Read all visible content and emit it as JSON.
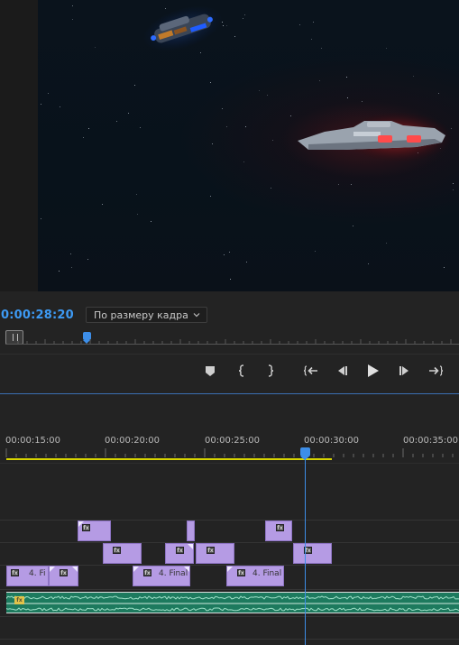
{
  "program_monitor": {
    "timecode": "0:00:28:20",
    "fit_mode": "По размеру кадра"
  },
  "transport": {
    "icons": [
      "marker-icon",
      "mark-in-icon",
      "mark-out-icon",
      "go-to-in-icon",
      "step-back-icon",
      "play-icon",
      "step-forward-icon",
      "go-to-out-icon"
    ]
  },
  "timeline": {
    "ruler_labels": [
      "00:00:15:00",
      "00:00:20:00",
      "00:00:25:00",
      "00:00:30:00",
      "00:00:35:00"
    ],
    "clips": {
      "v1_clip_1": "4. Fi",
      "v1_clip_3": "4. Final",
      "v1_clip_4": "4. Final"
    },
    "fx_badge": "fx"
  },
  "colors": {
    "accent": "#3d9af4",
    "clip": "#b59be4",
    "audio": "#1d7a5e",
    "work_area": "#d6d300"
  }
}
